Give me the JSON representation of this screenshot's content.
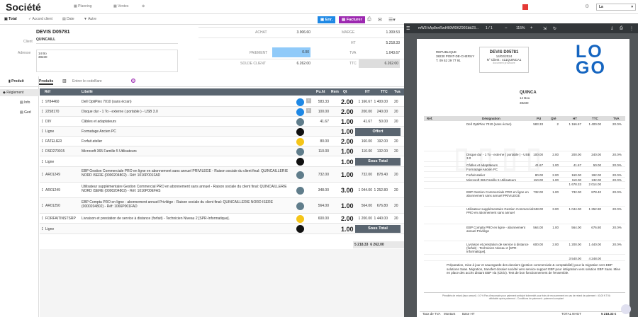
{
  "app": {
    "title": "Société",
    "nav": [
      "Planning",
      "Ventes"
    ],
    "user_select": "La"
  },
  "toolbar": {
    "tabs": [
      "Total",
      "Accord client",
      "Date",
      "Autre"
    ],
    "enr": "Enr.",
    "facturer": "Facturer"
  },
  "devis": {
    "title": "DEVIS D05781",
    "client_label": "Client",
    "client": "QUINCAILL",
    "address_label": "Adresse",
    "address_1": "14 Bo",
    "address_2": "38230"
  },
  "totals": {
    "achat_label": "ACHAT",
    "achat": "3.906.60",
    "paiement_label": "PAIEMENT",
    "paiement": "0.00",
    "solde_label": "SOLDE CLIENT",
    "solde": "6.262.00",
    "marge_label": "MARGE",
    "marge": "1.309.53",
    "ht_label": "HT",
    "ht": "5.218.33",
    "tva_label": "TVA",
    "tva": "1.043.67",
    "ttc_label": "TTC",
    "ttc": "6.262.00"
  },
  "product_tabs": {
    "produit": "Produit",
    "produits": "Produits",
    "scan_placeholder": "Entrer le codeBare"
  },
  "side": {
    "reglement": "Règlement",
    "info": "Info",
    "ged": "Ged"
  },
  "table": {
    "headers": [
      "Réf",
      "Libellé",
      "Pu.ht",
      "Rem",
      "Qt",
      "HT",
      "TTC",
      "Tva"
    ],
    "rows": [
      {
        "ref": "9784460",
        "label": "Dell OptiPlex 7010 (sans écran)",
        "pu": "583.33",
        "qt": "2.00",
        "ht": "1 166.67",
        "ttc": "1 400.00",
        "tva": "20",
        "dot": "#1e88e5"
      },
      {
        "ref": "2258170",
        "label": "Disque dur - 1 To - externe ( portable ) - USB 3.0",
        "pu": "100.00",
        "qt": "2.00",
        "ht": "200.00",
        "ttc": "240.00",
        "tva": "20",
        "dot": "#1e88e5"
      },
      {
        "ref": "DIV",
        "label": "Câbles et adaptateurs",
        "pu": "41.67",
        "qt": "1.00",
        "ht": "41.67",
        "ttc": "50.00",
        "tva": "20",
        "dot": "#607d8b"
      },
      {
        "ref": "Ligne",
        "label": "Formatage Ancien PC",
        "pu": "",
        "qt": "1.00",
        "ht": "",
        "ttc": "",
        "tva": "",
        "dot": "#111",
        "banner": "Offert"
      },
      {
        "ref": "FATELIER",
        "label": "Forfait atelier",
        "pu": "80.00",
        "qt": "2.00",
        "ht": "160.00",
        "ttc": "192.00",
        "tva": "20",
        "dot": "#f5c518"
      },
      {
        "ref": "DSD270015",
        "label": "Microsoft 365 Famille 5 Utilisateurs",
        "pu": "110.00",
        "qt": "1.00",
        "ht": "110.00",
        "ttc": "132.00",
        "tva": "20",
        "dot": "#607d8b"
      },
      {
        "ref": "Ligne",
        "label": "",
        "pu": "",
        "qt": "1.00",
        "ht": "",
        "ttc": "",
        "tva": "",
        "dot": "#111",
        "banner": "Sous Total"
      },
      {
        "ref": "AR01249",
        "label": "EBP Gestion Commerciale PRO en ligne en abonnement sans annuel PRIVILEGE - Raison sociale du client final: QUINCAILLERIE NORD ISERE (0000204802) - Réf: 1016P001FAD",
        "pu": "732.00",
        "qt": "1.00",
        "ht": "732.00",
        "ttc": "878.40",
        "tva": "20",
        "dot": "#607d8b"
      },
      {
        "ref": "AR01249",
        "label": "Utilisateur supplémentaire Gestion Commercial PRO en abonnement sans annuel - Raison sociale du client final: QUINCAILLERIE NORD ISERE (0000204802) - Réf: 1016P00EFAS",
        "pu": "348.00",
        "qt": "3.00",
        "ht": "1 044.00",
        "ttc": "1 252.80",
        "tva": "20",
        "dot": "#607d8b"
      },
      {
        "ref": "AR01250",
        "label": "EBP Compta PRO en ligne - abonnement annuel Privilège - Raison sociale du client final: QUINCAILLERIE NORD ISERE (0000204802) - Réf: 1066P001FAD",
        "pu": "564.00",
        "qt": "1.00",
        "ht": "564.00",
        "ttc": "676.80",
        "tva": "20",
        "dot": "#607d8b"
      },
      {
        "ref": "FORFAITINSTSRP",
        "label": "Livraison et prestation de service à distance (forfait) - Technicien Niveau 2 [SPR-Informatique].",
        "pu": "600.00",
        "qt": "2.00",
        "ht": "1 200.00",
        "ttc": "1 440.00",
        "tva": "20",
        "dot": "#f5c518"
      },
      {
        "ref": "Ligne",
        "label": "",
        "pu": "",
        "qt": "1.00",
        "ht": "",
        "ttc": "",
        "tva": "",
        "dot": "#111",
        "banner": "Sous Total"
      }
    ],
    "footer_ht": "5 218.33",
    "footer_ttc": "6 262.00"
  },
  "pdf": {
    "filename": "mW3-kAp8nnRzd4li9W0KZ90Sbb23...",
    "page": "1",
    "pages": "1",
    "zoom": "115%",
    "company": "REPUBLIQUE",
    "company_city": "38230 PONT-DE-CHERUY",
    "company_tel": "T. 09 52 29 77 91",
    "doc_title": "DEVIS D05781",
    "doc_date": "14/02/2024",
    "doc_client": "N° Client : 411QUINCA1",
    "doc_note": "document provisoire",
    "logo_1": "LO",
    "logo_2": "GO",
    "cust_name": "QUINCA",
    "cust_addr1": "14 Bou",
    "cust_addr2": "38230",
    "headers": [
      "Réf.",
      "Désignation",
      "PU",
      "Qté",
      "HT",
      "TTC",
      "TVA"
    ],
    "lines": [
      {
        "d": "Dell OptiPlex 7010 (sans écran)",
        "pu": "583.33",
        "q": "2",
        "ht": "1 166.67",
        "ttc": "1 400.00",
        "tva": "20.0%"
      },
      {
        "d": "Disque dur - 1 To - externe ( portable ) - USB 3.0",
        "pu": "100.00",
        "q": "2.00",
        "ht": "200.00",
        "ttc": "240.00",
        "tva": "20.0%"
      },
      {
        "d": "Câbles et adaptateurs",
        "pu": "41.67",
        "q": "1.00",
        "ht": "41.67",
        "ttc": "50.00",
        "tva": "20.0%"
      },
      {
        "d": "Formatage Ancien PC",
        "pu": "",
        "q": "",
        "ht": "",
        "ttc": "",
        "tva": ""
      },
      {
        "d": "Forfait atelier",
        "pu": "80.00",
        "q": "2.00",
        "ht": "160.00",
        "ttc": "192.00",
        "tva": "20.0%"
      },
      {
        "d": "Microsoft 365 Famille 5 Utilisateurs",
        "pu": "110.00",
        "q": "1.00",
        "ht": "110.00",
        "ttc": "132.00",
        "tva": "20.0%"
      },
      {
        "d": "",
        "pu": "",
        "q": "",
        "ht": "1 678.33",
        "ttc": "2 014.00",
        "tva": ""
      },
      {
        "d": "EBP Gestion Commerciale PRO en ligne en abonnement sans annuel PRIVILEGE",
        "pu": "732.00",
        "q": "1.00",
        "ht": "732.00",
        "ttc": "878.40",
        "tva": "20.0%"
      },
      {
        "d": "Utilisateur supplémentaire Gestion Commercial PRO en abonnement sans annuel",
        "pu": "348.00",
        "q": "3.00",
        "ht": "1 044.00",
        "ttc": "1 252.80",
        "tva": "20.0%"
      },
      {
        "d": "EBP Compta PRO en ligne - abonnement annuel Privilège",
        "pu": "564.00",
        "q": "1.00",
        "ht": "564.00",
        "ttc": "676.80",
        "tva": "20.0%"
      },
      {
        "d": "Livraison et prestation de service à distance (forfait) - Technicien Niveau 2 [SPR-Informatique].",
        "pu": "600.00",
        "q": "2.00",
        "ht": "1 200.00",
        "ttc": "1 440.00",
        "tva": "20.0%"
      },
      {
        "d": "",
        "pu": "",
        "q": "",
        "ht": "3 540.00",
        "ttc": "4 248.00",
        "tva": ""
      }
    ],
    "note": "Préparation, mise à jour et sauvegarde des dossiers (gestion commerciale & comptabilité) pour la migration vers EBP solutions Saas. Migration, transfert dossier société vers service support EBP pour intégration vers solution EBP Saas. Mise en place des accès distant EBP via (Citrix). Test de bon fonctionnement de l'ensemble.",
    "foot_1": "Pénalités de retard (taux annuel) : 10 % Pas d'escompte pour paiement anticipé Indemnité pour frais de recouvrement en cas de retard de paiement : 40,00 € TVA débitable après paiement - Conditions de paiement : paiement comptant",
    "foot_taux": "Taux de TVA",
    "foot_montant": "Montant",
    "foot_base": "Base HT",
    "foot_total": "TOTAL NHGT",
    "foot_total_val": "5 218.33 €"
  }
}
